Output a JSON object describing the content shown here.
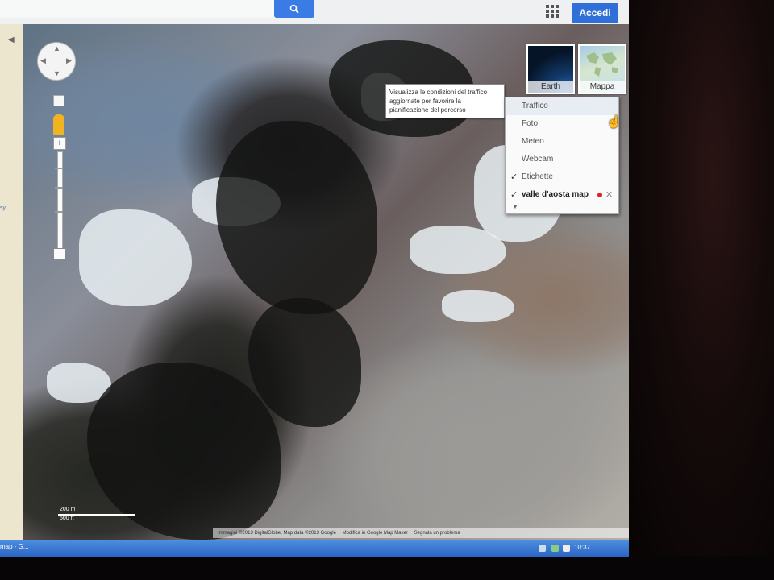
{
  "header": {
    "search_placeholder": "",
    "apps_icon": "apps-grid-icon",
    "signin_label": "Accedi",
    "accent": "#2f6fd8"
  },
  "left_panel": {
    "snippet": "sy"
  },
  "map": {
    "type_tiles": [
      {
        "label": "Earth"
      },
      {
        "label": "Mappa"
      }
    ],
    "tooltip": "Visualizza le condizioni del traffico aggiornate per favorire la pianificazione del percorso",
    "layers": [
      {
        "label": "Traffico",
        "checked": false
      },
      {
        "label": "Foto",
        "checked": false
      },
      {
        "label": "Meteo",
        "checked": false
      },
      {
        "label": "Webcam",
        "checked": false
      },
      {
        "label": "Etichette",
        "checked": true
      },
      {
        "label": "valle d'aosta map",
        "checked": true
      }
    ],
    "scale": {
      "metric": "200 m",
      "imperial": "500 ft"
    },
    "footer": {
      "attribution": "Immagini ©2013 DigitalGlobe, Map data ©2013 Google",
      "report": "Modifica in Google Map Maker",
      "problem": "Segnala un problema"
    }
  },
  "taskbar": {
    "active_item": "map - G...",
    "clock": "10:37"
  }
}
